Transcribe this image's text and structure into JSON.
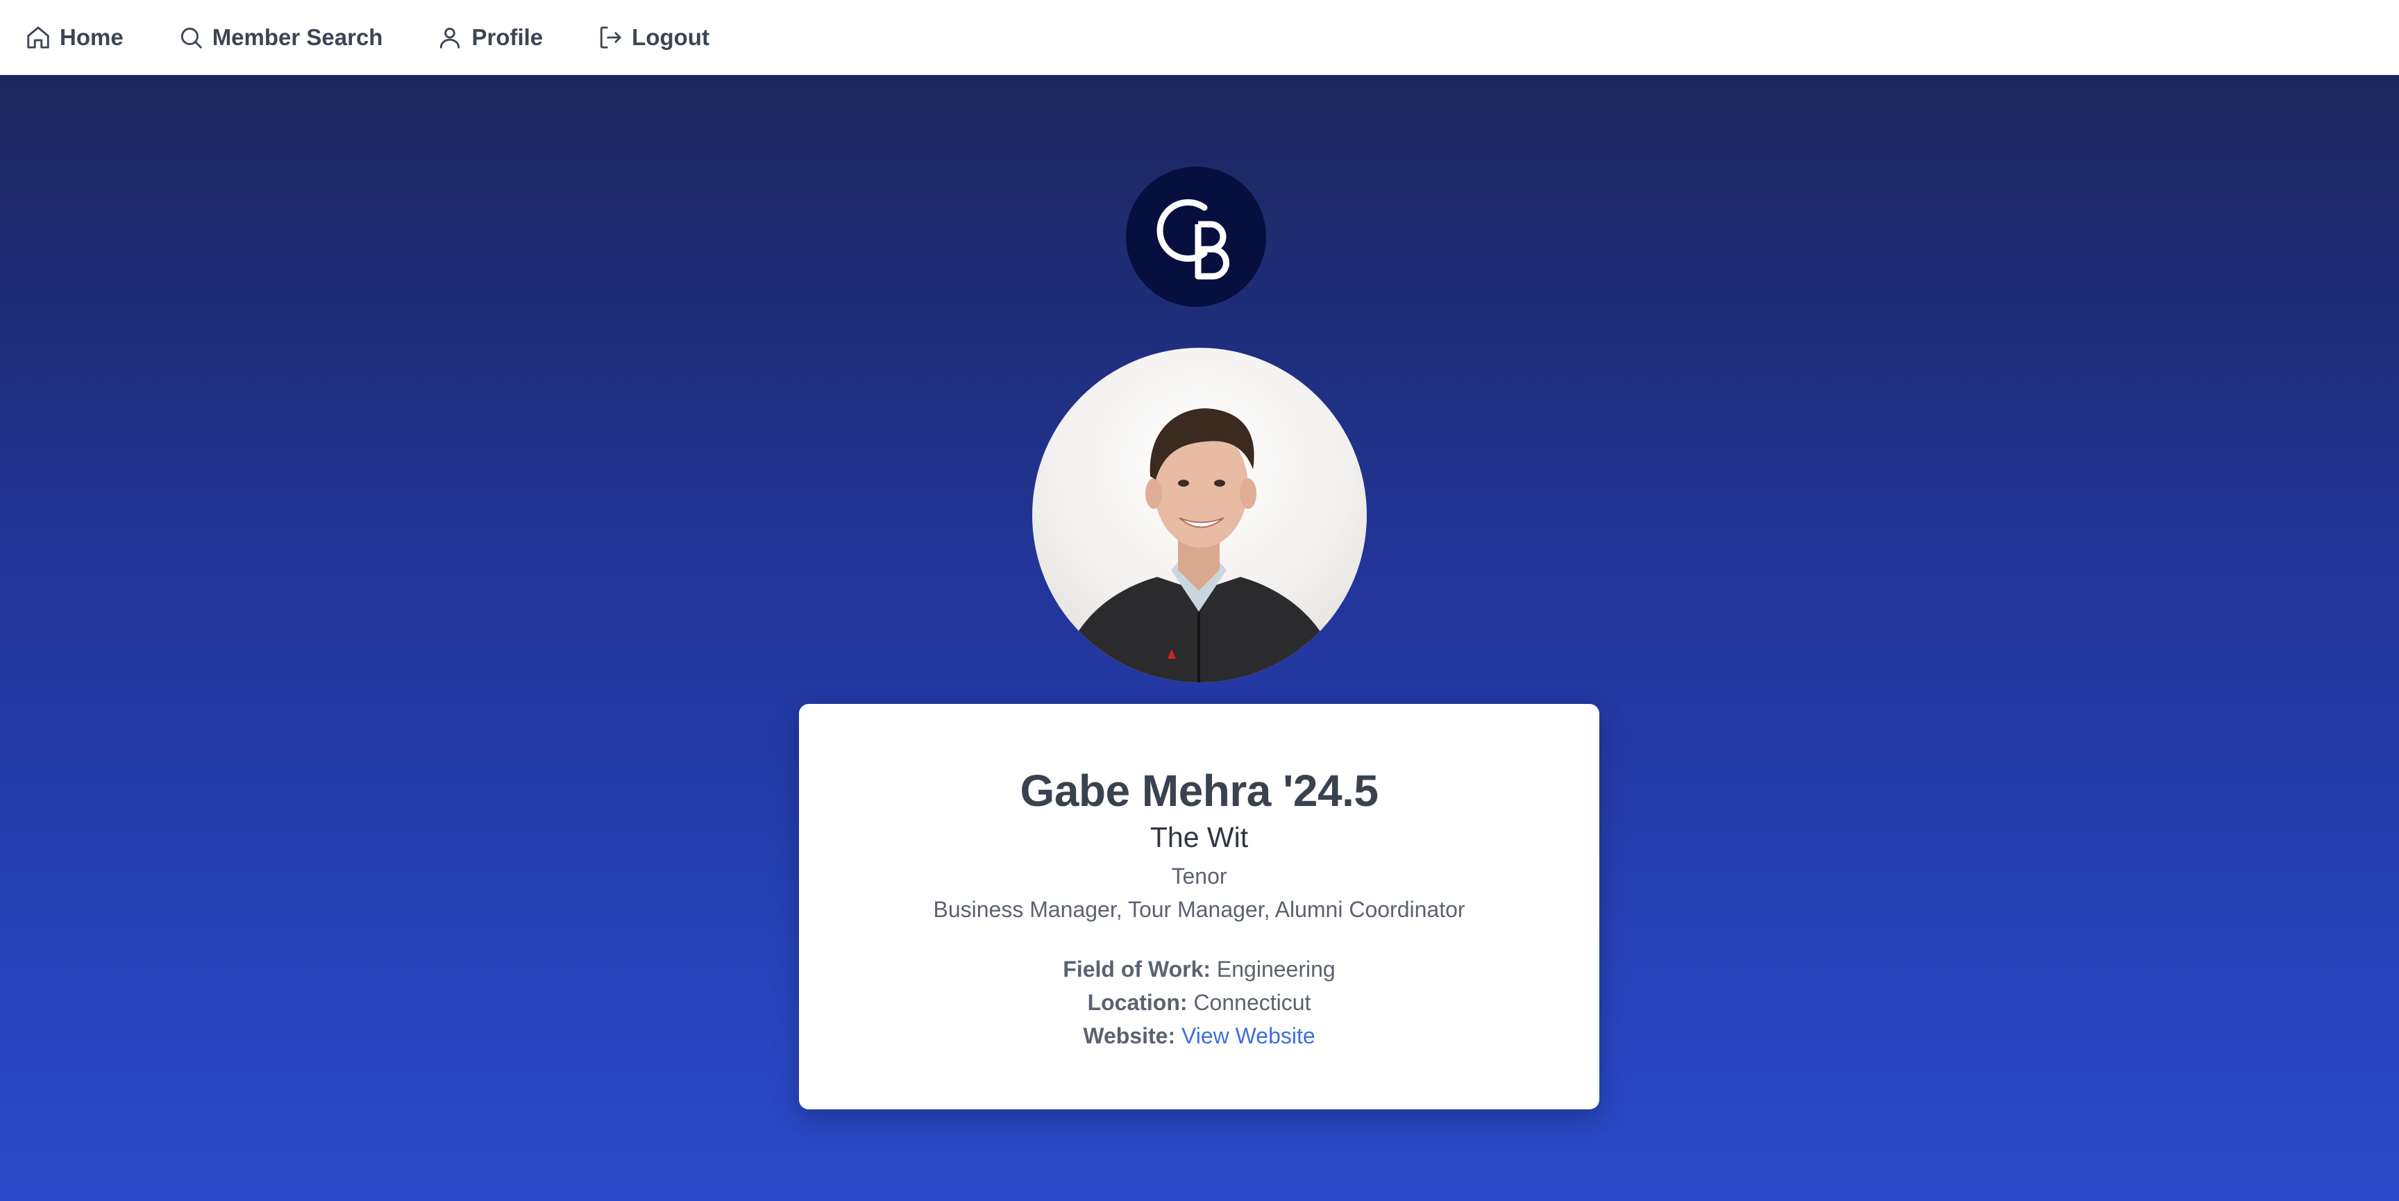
{
  "nav": {
    "items": [
      {
        "label": "Home",
        "icon": "home-icon"
      },
      {
        "label": "Member Search",
        "icon": "search-icon"
      },
      {
        "label": "Profile",
        "icon": "user-icon"
      },
      {
        "label": "Logout",
        "icon": "logout-icon"
      }
    ]
  },
  "logo": {
    "text": "CB"
  },
  "profile": {
    "name": "Gabe Mehra '24.5",
    "group": "The Wit",
    "voice_part": "Tenor",
    "roles": "Business Manager, Tour Manager, Alumni Coordinator",
    "field_of_work_label": "Field of Work:",
    "field_of_work": "Engineering",
    "location_label": "Location:",
    "location": "Connecticut",
    "website_label": "Website:",
    "website_link_text": "View Website"
  },
  "colors": {
    "nav_text": "#3d4553",
    "gradient_top": "#1c275c",
    "gradient_bottom": "#2a4bcb",
    "logo_bg": "#070f3f",
    "link": "#3f6ee0"
  }
}
